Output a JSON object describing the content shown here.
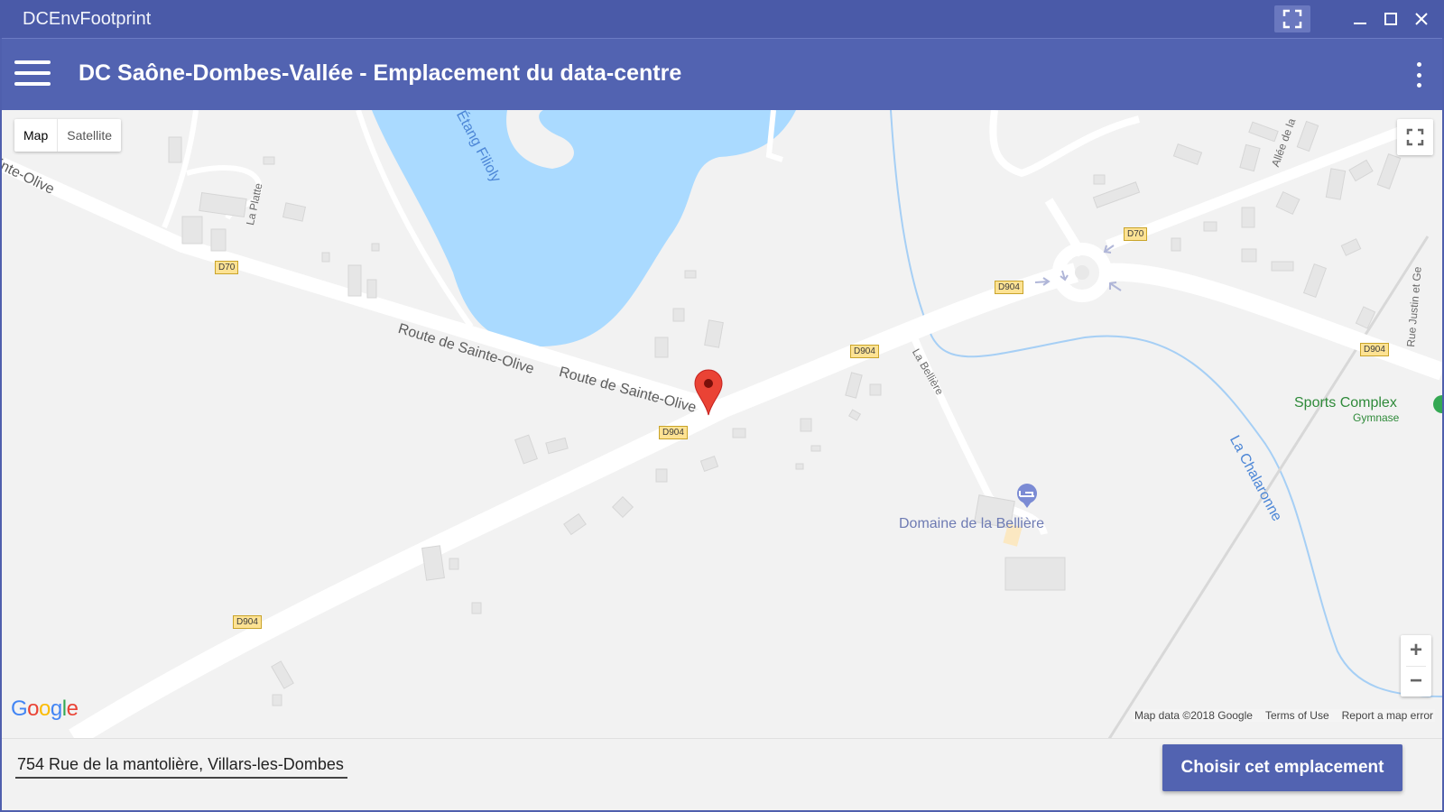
{
  "window": {
    "title": "DCEnvFootprint",
    "controls": [
      "fullscreen-icon",
      "minimize-icon",
      "maximize-icon",
      "close-icon"
    ]
  },
  "appbar": {
    "title": "DC Saône-Dombes-Vallée - Emplacement du data-centre",
    "menu_icon": "hamburger-icon",
    "more_icon": "more-vert-icon"
  },
  "map": {
    "type_controls": {
      "map": "Map",
      "satellite": "Satellite",
      "selected": "Map"
    },
    "labels": {
      "route1": "Route de Sainte-Olive",
      "route2": "Route de Sainte-Olive",
      "route_partial": "inte-Olive",
      "la_platte": "La Platte",
      "etang": "Étang Filioly",
      "allee": "Allée de la",
      "rue_justin": "Rue Justin et Ge",
      "la_belliere": "La Bellière",
      "la_chalaronne": "La Chalaronne",
      "domaine": "Domaine de la Bellière",
      "sports": "Sports Complex",
      "gymnase": "Gymnase"
    },
    "shields": {
      "d70_left": "D70",
      "d70_right": "D70",
      "d904_mid": "D904",
      "d904_center": "D904",
      "d904_upper": "D904",
      "d904_right": "D904",
      "d904_bottom": "D904"
    },
    "zoom": {
      "in": "+",
      "out": "−"
    },
    "logo": [
      "G",
      "o",
      "o",
      "g",
      "l",
      "e"
    ],
    "attribution": {
      "data": "Map data ©2018 Google",
      "terms": "Terms of Use",
      "report": "Report a map error"
    },
    "marker": "map-pin-icon"
  },
  "bottom": {
    "address": "754 Rue de la mantolière, Villars-les-Dombes",
    "button": "Choisir cet emplacement"
  },
  "colors": {
    "primary": "#5263b1",
    "titlebar": "#4a5aa8",
    "water": "#aadaff",
    "marker": "#ea4335",
    "land": "#f2f2f2"
  }
}
